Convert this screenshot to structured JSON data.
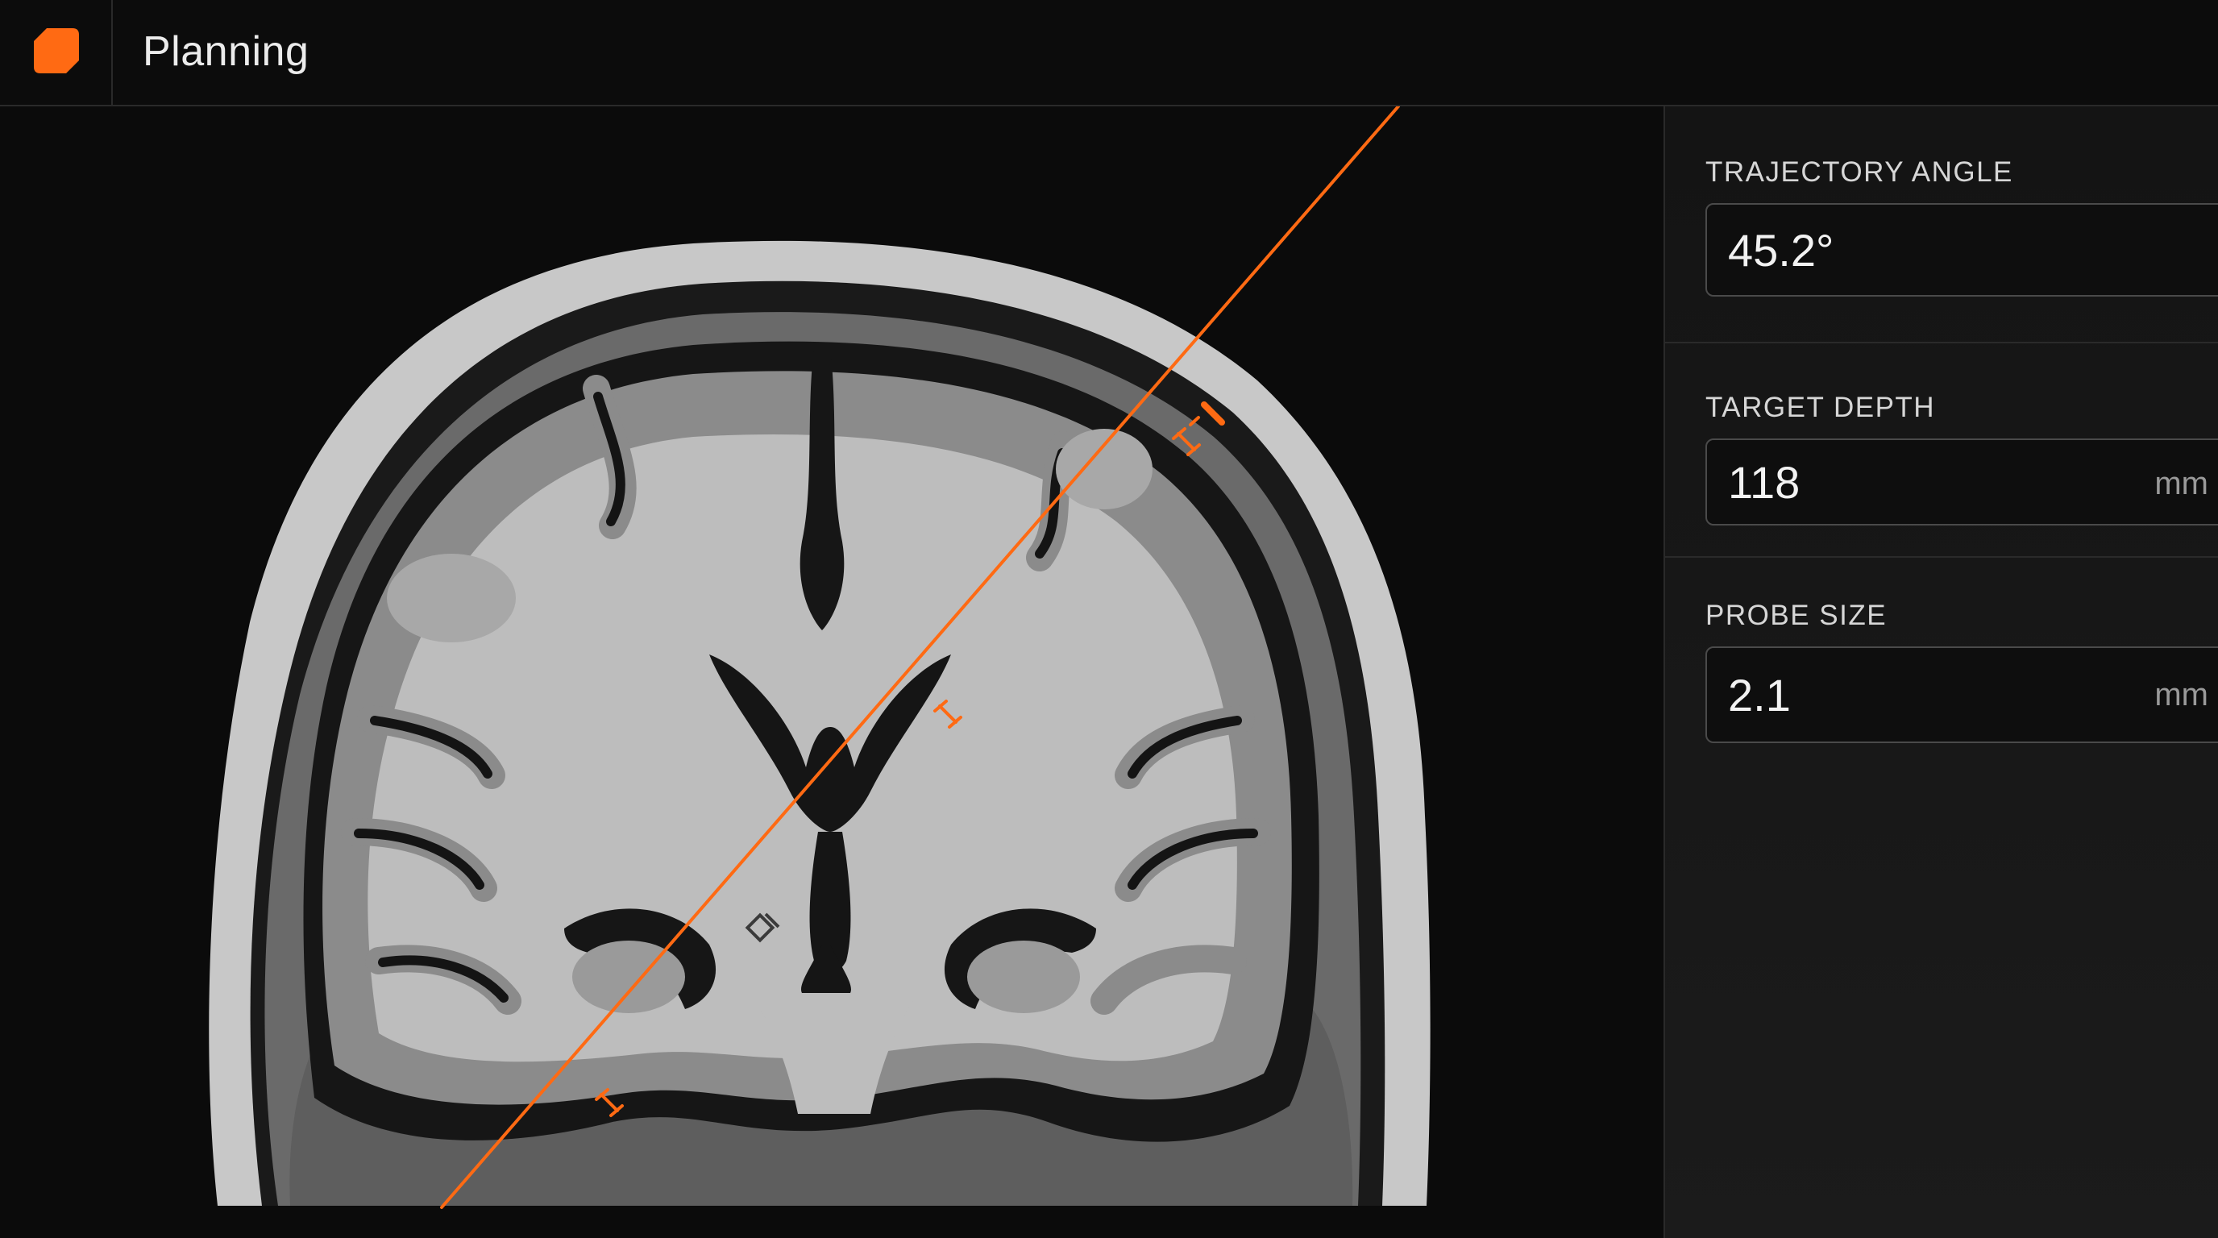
{
  "header": {
    "title": "Planning",
    "accent_color": "#ff6a13",
    "logo_icon": "app-logo-icon"
  },
  "viewer": {
    "view": "coronal brain MRI slice",
    "trajectory_color": "#ff6a13"
  },
  "panel": {
    "trajectory_angle": {
      "label": "TRAJECTORY ANGLE",
      "value": "45.2°"
    },
    "target_depth": {
      "label": "TARGET DEPTH",
      "value": "118",
      "unit": "mm"
    },
    "probe_size": {
      "label": "PROBE SIZE",
      "value": "2.1",
      "unit": "mm"
    }
  }
}
